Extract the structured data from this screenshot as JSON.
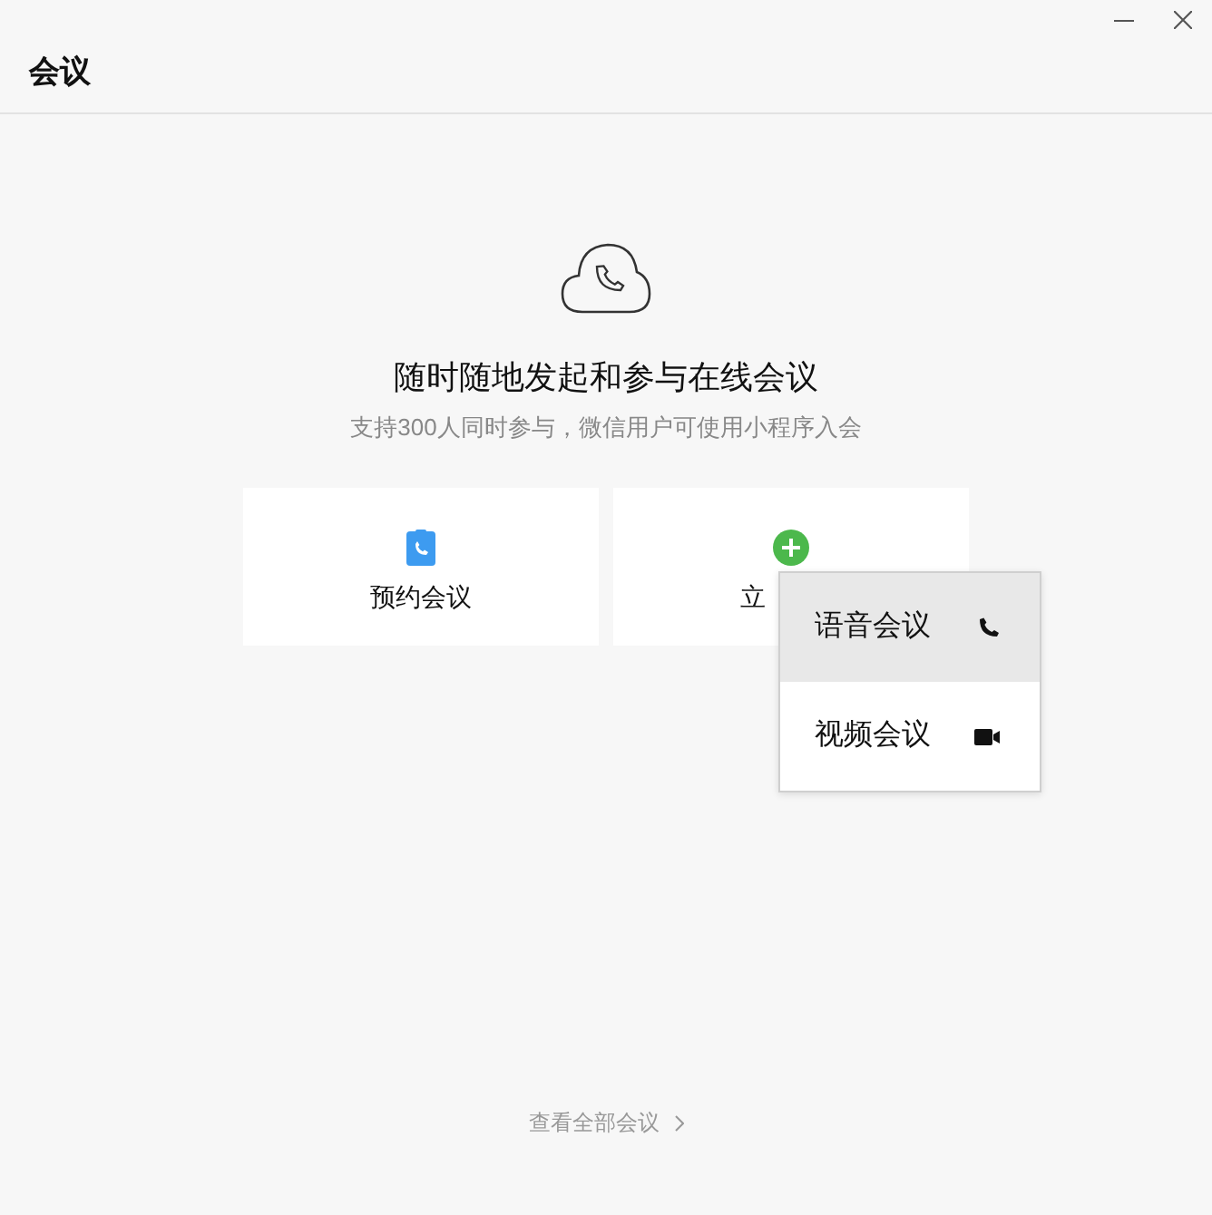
{
  "window": {
    "title": "会议"
  },
  "hero": {
    "heading": "随时随地发起和参与在线会议",
    "subtitle": "支持300人同时参与，微信用户可使用小程序入会"
  },
  "cards": [
    {
      "kind": "schedule",
      "label": "预约会议"
    },
    {
      "kind": "instant",
      "label": "立"
    }
  ],
  "menu": [
    {
      "kind": "phone",
      "label": "语音会议",
      "selected": true
    },
    {
      "kind": "video",
      "label": "视频会议",
      "selected": false
    }
  ],
  "footer_link": "查看全部会议"
}
